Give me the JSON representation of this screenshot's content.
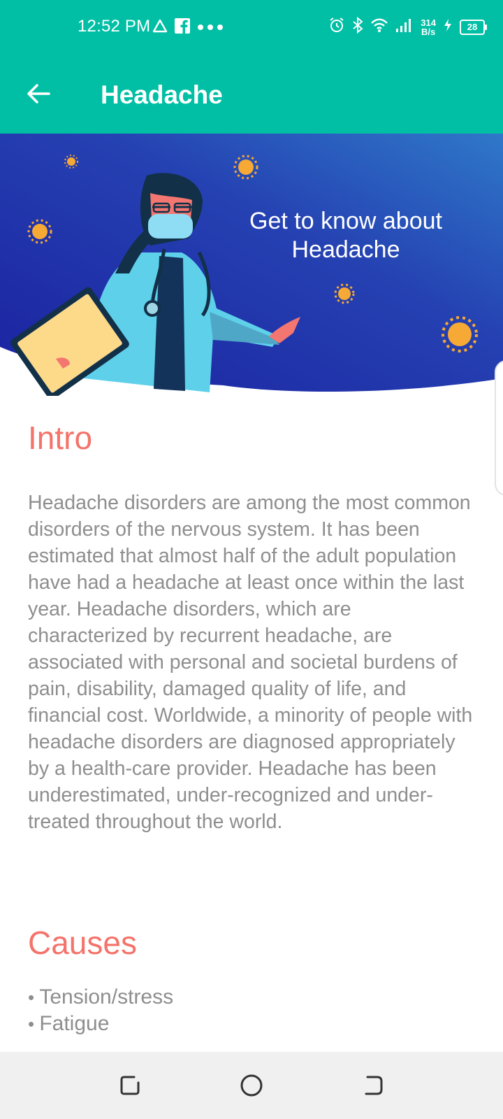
{
  "status": {
    "time": "12:52 PM",
    "net_speed_value": "314",
    "net_speed_unit": "B/s",
    "battery": "28",
    "icons": [
      "warning-icon",
      "facebook-icon",
      "more-dots-icon",
      "alarm-icon",
      "bluetooth-icon",
      "wifi-icon",
      "signal-icon",
      "charging-icon",
      "battery-icon"
    ]
  },
  "appbar": {
    "title": "Headache",
    "back_icon": "arrow-left-icon"
  },
  "banner": {
    "line1": "Get to know about",
    "line2": "Headache"
  },
  "sections": {
    "intro_title": "Intro",
    "intro_text": "Headache disorders are among the most common disorders of the nervous system. It has been estimated that almost half of the adult population have had a headache at least once within the last year. Headache disorders, which are characterized by recurrent headache, are associated with personal and societal burdens of pain, disability, damaged quality of life, and financial cost. Worldwide, a minority of people with headache disorders are diagnosed appropriately by a health-care provider. Headache has been underestimated, under-recognized and under-treated throughout the world.",
    "causes_title": "Causes",
    "causes": [
      "Tension/stress",
      "Fatigue"
    ]
  },
  "navbar": {
    "icons": [
      "recents-icon",
      "home-icon",
      "back-icon"
    ]
  },
  "colors": {
    "appbar": "#00BFA5",
    "heading": "#F4736A",
    "body_text": "#8E8E8E",
    "banner_start": "#1B2A9E",
    "banner_end": "#2D6FC8"
  }
}
